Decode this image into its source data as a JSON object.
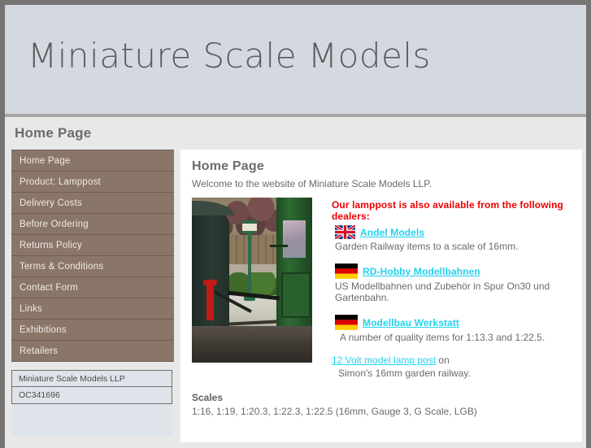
{
  "site": {
    "title": "Miniature Scale Models"
  },
  "titlebar": {
    "text": "Home Page"
  },
  "sidebar": {
    "items": [
      {
        "label": "Home Page"
      },
      {
        "label": "Product: Lamppost"
      },
      {
        "label": "Delivery Costs"
      },
      {
        "label": "Before Ordering"
      },
      {
        "label": "Returns Policy"
      },
      {
        "label": "Terms & Conditions"
      },
      {
        "label": "Contact Form"
      },
      {
        "label": "Links"
      },
      {
        "label": "Exhibitions"
      },
      {
        "label": "Retailers"
      }
    ],
    "info": {
      "company": "Miniature Scale Models LLP",
      "registration": "OC341696"
    }
  },
  "main": {
    "heading": "Home Page",
    "intro": "Welcome to the website of Miniature Scale Models LLP.",
    "dealers_title": "Our lamppost is also available from the following dealers:",
    "dealers": [
      {
        "flag": "uk-flag-icon",
        "name": "Andel Models",
        "description": "Garden Railway items to a scale of 16mm."
      },
      {
        "flag": "germany-flag-icon",
        "name": "RD-Hobby Modellbahnen",
        "description": "US Modellbahnen und Zubehör in Spur On30 und Gartenbahn."
      },
      {
        "flag": "germany-flag-icon",
        "name": "Modellbau Werkstatt",
        "description": "A number of quality items for 1:13.3 and 1:22.5."
      }
    ],
    "credit": {
      "link": "12 Volt model lamp post",
      "after_link": " on",
      "line2": "Simon's 16mm garden railway."
    },
    "scales": {
      "heading": "Scales",
      "text": "1:16, 1:19, 1:20.3, 1:22.3, 1:22.5 (16mm, Gauge 3, G Scale, LGB)"
    },
    "photo_alt": "garden-railway-lamppost-photo"
  },
  "colors": {
    "page_background": "#757373",
    "masthead": "#d4d9e1",
    "nav_button": "#8a7668",
    "dealers_title": "#ee0000",
    "link": "#22d2ef",
    "content_background": "#ffffff"
  }
}
